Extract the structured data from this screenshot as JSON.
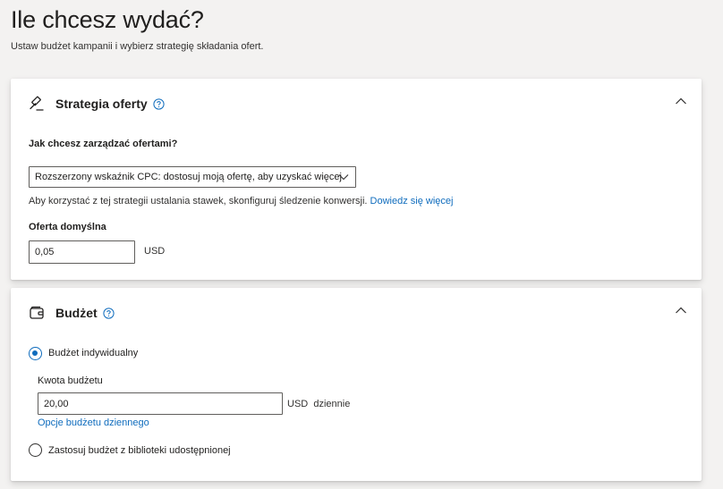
{
  "page": {
    "title": "Ile chcesz wydać?",
    "subtitle": "Ustaw budżet kampanii i wybierz strategię składania ofert."
  },
  "strategy": {
    "title": "Strategia oferty",
    "icon": "gavel-icon",
    "question": "Jak chcesz zarządzać ofertami?",
    "selected_option": "Rozszerzony wskaźnik CPC: dostosuj moją ofertę, aby uzyskać więcej",
    "hint_text": "Aby korzystać z tej strategii ustalania stawek, skonfiguruj śledzenie konwersji. ",
    "hint_link": "Dowiedz się więcej",
    "default_bid_label": "Oferta domyślna",
    "default_bid_value": "0,05",
    "default_bid_unit": "USD"
  },
  "budget": {
    "title": "Budżet",
    "icon": "wallet-icon",
    "option_individual": "Budżet indywidualny",
    "amount_label": "Kwota budżetu",
    "amount_value": "20,00",
    "amount_unit": "USD  dziennie",
    "daily_options_link": "Opcje budżetu dziennego",
    "option_shared": "Zastosuj budżet z biblioteki udostępnionej",
    "selected": "individual"
  },
  "colors": {
    "accent": "#0f6cbd",
    "background": "#f3f2f1",
    "card": "#ffffff"
  }
}
